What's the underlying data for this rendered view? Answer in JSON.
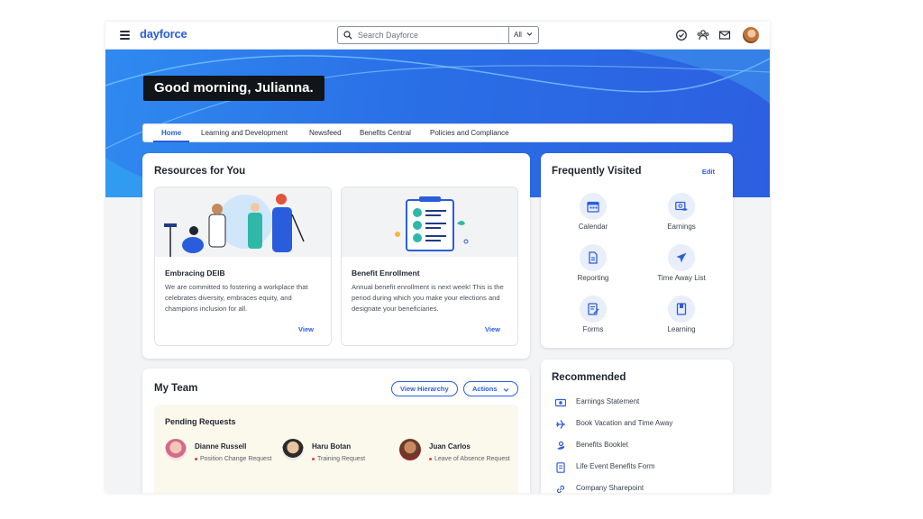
{
  "header": {
    "brand": "dayforce",
    "search_placeholder": "Search Dayforce",
    "search_scope": "All",
    "icons": [
      "check-circle-icon",
      "people-icon",
      "mail-icon",
      "user-avatar"
    ]
  },
  "hero": {
    "greeting": "Good morning, Julianna."
  },
  "tabs": [
    {
      "label": "Home",
      "active": true
    },
    {
      "label": "Learning and Development",
      "active": false
    },
    {
      "label": "Newsfeed",
      "active": false
    },
    {
      "label": "Benefits Central",
      "active": false
    },
    {
      "label": "Policies and Compliance",
      "active": false
    }
  ],
  "resources": {
    "title": "Resources for You",
    "items": [
      {
        "name": "Embracing DEIB",
        "description": "We are committed to fostering a workplace that celebrates diversity, embraces equity, and champions inclusion for all.",
        "action": "View"
      },
      {
        "name": "Benefit Enrollment",
        "description": "Annual benefit enrollment is next week! This is the period during which you make your elections and designate your beneficiaries.",
        "action": "View"
      }
    ]
  },
  "frequently_visited": {
    "title": "Frequently Visited",
    "edit_label": "Edit",
    "items": [
      {
        "label": "Calendar",
        "icon": "calendar-icon"
      },
      {
        "label": "Earnings",
        "icon": "earnings-icon"
      },
      {
        "label": "Reporting",
        "icon": "document-icon"
      },
      {
        "label": "Time Away List",
        "icon": "airplane-icon"
      },
      {
        "label": "Forms",
        "icon": "form-icon"
      },
      {
        "label": "Learning",
        "icon": "book-icon"
      }
    ]
  },
  "my_team": {
    "title": "My Team",
    "view_hierarchy_label": "View Hierarchy",
    "actions_label": "Actions",
    "pending_title": "Pending Requests",
    "requests": [
      {
        "name": "Dianne Russell",
        "type": "Position Change Request"
      },
      {
        "name": "Haru Botan",
        "type": "Training Request"
      },
      {
        "name": "Juan Carlos",
        "type": "Leave of Absence Request"
      }
    ]
  },
  "recommended": {
    "title": "Recommended",
    "items": [
      {
        "label": "Earnings Statement",
        "icon": "money-icon"
      },
      {
        "label": "Book Vacation and Time Away",
        "icon": "plane-icon"
      },
      {
        "label": "Benefits Booklet",
        "icon": "benefits-icon"
      },
      {
        "label": "Life Event Benefits Form",
        "icon": "form-icon"
      },
      {
        "label": "Company Sharepoint",
        "icon": "link-icon"
      }
    ]
  },
  "colors": {
    "accent": "#2a5ddc",
    "hero": "#2a6fe6",
    "pending_bg": "#fbf8ec"
  }
}
